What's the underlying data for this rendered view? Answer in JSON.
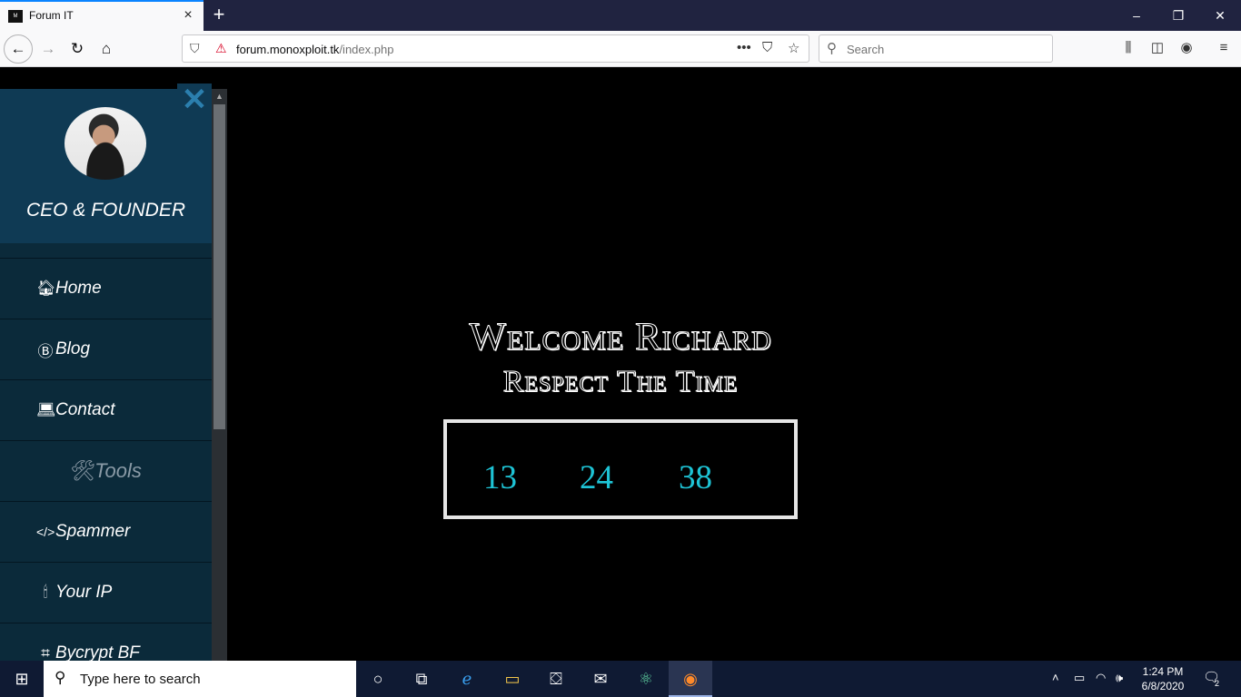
{
  "browser": {
    "tab_title": "Forum IT",
    "tab_favicon_text": "M",
    "url_domain": "forum.monoxploit.tk",
    "url_path": "/index.php",
    "search_placeholder": "Search",
    "window_controls": {
      "minimize": "–",
      "restore": "❐",
      "close": "✕"
    }
  },
  "sidebar": {
    "role": "CEO & FOUNDER",
    "close_symbol": "✕",
    "items": [
      {
        "label": "Home",
        "icon": "home-icon",
        "glyph": "🏠︎"
      },
      {
        "label": "Blog",
        "icon": "blog-icon",
        "glyph": "Ⓑ"
      },
      {
        "label": "Contact",
        "icon": "laptop-icon",
        "glyph": "💻︎"
      },
      {
        "label": "Tools",
        "icon": "tools-icon",
        "glyph": "🛠︎"
      },
      {
        "label": "Spammer",
        "icon": "code-icon",
        "glyph": "</>"
      },
      {
        "label": "Your IP",
        "icon": "marker-icon",
        "glyph": "🕯︎"
      },
      {
        "label": "Bycrypt BF",
        "icon": "vector-icon",
        "glyph": "⌗"
      }
    ]
  },
  "main": {
    "welcome": "Welcome Richard",
    "subtitle": "Respect The Time",
    "clock": {
      "hours": "13",
      "minutes": "24",
      "seconds": "38"
    }
  },
  "taskbar": {
    "search_placeholder": "Type here to search",
    "time": "1:24 PM",
    "date": "6/8/2020",
    "notifications": "2"
  },
  "colors": {
    "sidebar_bg": "#0b2a3a",
    "profile_bg": "#0f3a54",
    "clock_digits": "#1ec4d6",
    "page_bg": "#000000"
  }
}
